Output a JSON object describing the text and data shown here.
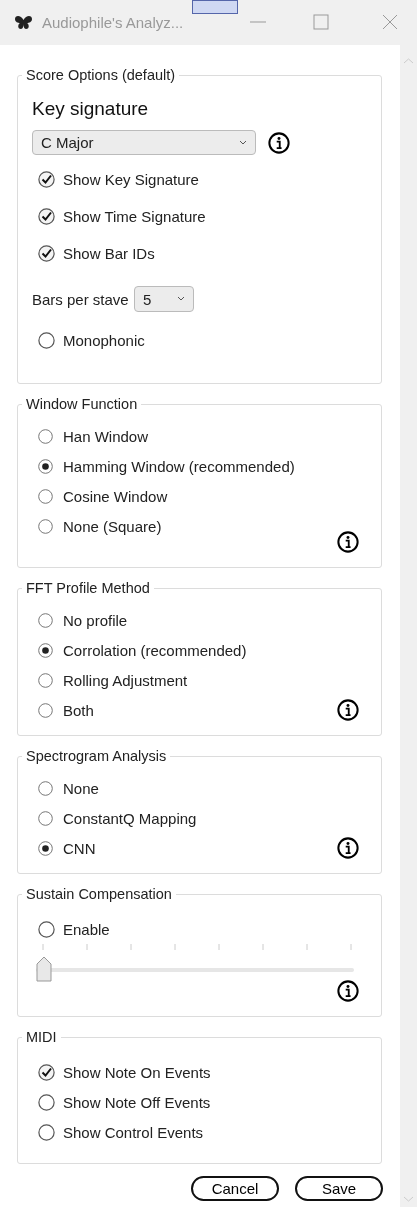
{
  "window": {
    "title": "Audiophile's Analyz..."
  },
  "groups": [
    {
      "title": "Score Options (default)",
      "info": false,
      "items": [
        {
          "kind": "heading",
          "label": "Key signature"
        },
        {
          "kind": "dropdown",
          "value": "C Major",
          "info": true
        },
        {
          "kind": "checkbox",
          "label": "Show Key Signature",
          "checked": true
        },
        {
          "kind": "checkbox",
          "label": "Show Time Signature",
          "checked": true
        },
        {
          "kind": "checkbox",
          "label": "Show Bar IDs",
          "checked": true
        },
        {
          "kind": "select",
          "label": "Bars per stave",
          "value": "5"
        },
        {
          "kind": "checkbox",
          "label": "Monophonic",
          "checked": false
        }
      ]
    },
    {
      "title": "Window Function",
      "info": true,
      "items": [
        {
          "kind": "radio",
          "label": "Han Window",
          "selected": false
        },
        {
          "kind": "radio",
          "label": "Hamming Window (recommended)",
          "selected": true
        },
        {
          "kind": "radio",
          "label": "Cosine Window",
          "selected": false
        },
        {
          "kind": "radio",
          "label": "None (Square)",
          "selected": false
        }
      ]
    },
    {
      "title": "FFT Profile Method",
      "info": true,
      "items": [
        {
          "kind": "radio",
          "label": "No profile",
          "selected": false
        },
        {
          "kind": "radio",
          "label": "Corrolation (recommended)",
          "selected": true
        },
        {
          "kind": "radio",
          "label": "Rolling Adjustment",
          "selected": false
        },
        {
          "kind": "radio",
          "label": "Both",
          "selected": false
        }
      ]
    },
    {
      "title": "Spectrogram Analysis",
      "info": true,
      "items": [
        {
          "kind": "radio",
          "label": "None",
          "selected": false
        },
        {
          "kind": "radio",
          "label": "ConstantQ Mapping",
          "selected": false
        },
        {
          "kind": "radio",
          "label": "CNN",
          "selected": true
        }
      ]
    },
    {
      "title": "Sustain Compensation",
      "info": true,
      "items": [
        {
          "kind": "checkbox",
          "label": "Enable",
          "checked": false
        },
        {
          "kind": "slider",
          "level": 0
        }
      ]
    },
    {
      "title": "MIDI",
      "info": false,
      "items": [
        {
          "kind": "checkbox",
          "label": "Show Note On Events",
          "checked": true
        },
        {
          "kind": "checkbox",
          "label": "Show Note Off Events",
          "checked": false
        },
        {
          "kind": "checkbox",
          "label": "Show Control Events",
          "checked": false
        }
      ]
    }
  ],
  "buttons": [
    "Cancel",
    "Save"
  ]
}
